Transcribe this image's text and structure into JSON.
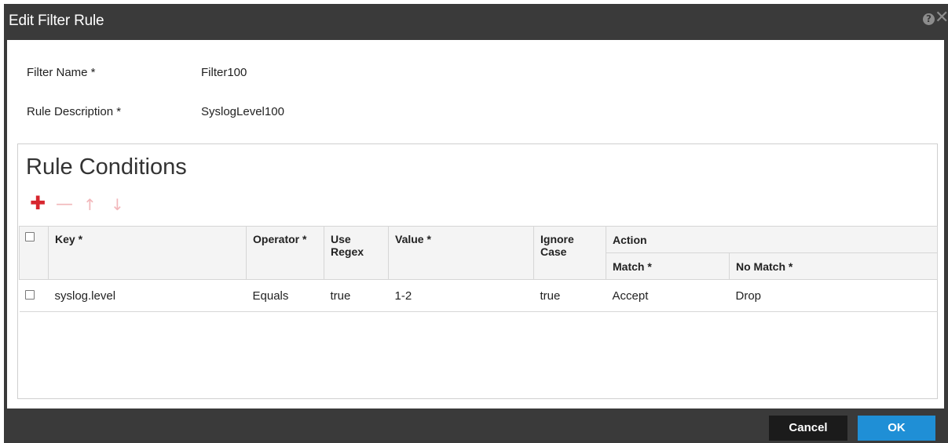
{
  "dialog": {
    "title": "Edit Filter Rule",
    "help_glyph": "?",
    "close_glyph": "✕"
  },
  "form": {
    "filter_name_label": "Filter Name *",
    "filter_name_value": "Filter100",
    "rule_description_label": "Rule Description *",
    "rule_description_value": "SyslogLevel100"
  },
  "rule_conditions": {
    "title": "Rule Conditions",
    "toolbar": {
      "add_glyph": "✚",
      "remove_glyph": "—",
      "move_up_glyph": "↑",
      "move_down_glyph": "↓"
    },
    "columns": {
      "key": "Key *",
      "operator": "Operator *",
      "use_regex": "Use Regex",
      "value": "Value *",
      "ignore_case": "Ignore Case",
      "action": "Action",
      "match": "Match *",
      "no_match": "No Match *"
    },
    "rows": [
      {
        "key": "syslog.level",
        "operator": "Equals",
        "use_regex": "true",
        "value": "1-2",
        "ignore_case": "true",
        "match": "Accept",
        "no_match": "Drop"
      }
    ]
  },
  "footer": {
    "cancel_label": "Cancel",
    "ok_label": "OK"
  },
  "colors": {
    "titlebar": "#3a3a3a",
    "add_accent": "#d7262e",
    "ok_button": "#1f8fd6",
    "cancel_button": "#1b1b1b"
  }
}
